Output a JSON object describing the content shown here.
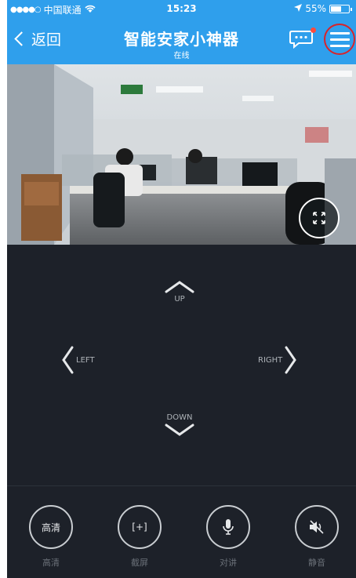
{
  "status_bar": {
    "signal": "●●●●○",
    "carrier": "中国联通",
    "time": "15:23",
    "battery_percent": "55%",
    "battery_level": 0.55
  },
  "nav": {
    "back_label": "返回",
    "title": "智能安家小神器",
    "subtitle": "在线"
  },
  "ptz": {
    "up": "UP",
    "down": "DOWN",
    "left": "LEFT",
    "right": "RIGHT"
  },
  "toolbar": [
    {
      "icon_text": "高清",
      "label": "高清",
      "icon": "hd-icon"
    },
    {
      "icon_text": "[+]",
      "label": "截屏",
      "icon": "screenshot-icon"
    },
    {
      "icon_text": "",
      "label": "对讲",
      "icon": "microphone-icon"
    },
    {
      "icon_text": "",
      "label": "静音",
      "icon": "mute-icon"
    }
  ],
  "colors": {
    "nav_blue": "#2f9fec",
    "background": "#1d2129",
    "badge_red": "#ff4a3c",
    "highlight_ring": "#d8232a"
  }
}
